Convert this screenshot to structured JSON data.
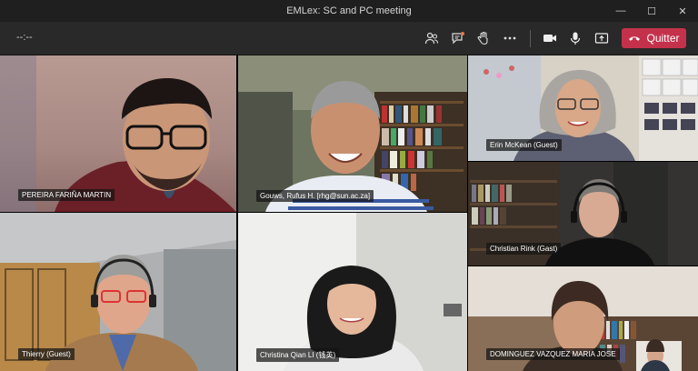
{
  "window": {
    "title": "EMLex: SC and PC meeting",
    "minimize": "—",
    "maximize": "☐",
    "close": "✕"
  },
  "toolbar": {
    "timer": "--:--",
    "leave_label": "Quitter"
  },
  "colors": {
    "accent_leave": "#c4314b",
    "toolbar_bg": "#292929",
    "titlebar_bg": "#1f1f1f"
  },
  "participants": [
    {
      "name": "PEREIRA FARIÑA MARTIN"
    },
    {
      "name": "Gouws, Rufus H. [rhg@sun.ac.za]"
    },
    {
      "name": "Erin McKean (Guest)"
    },
    {
      "name": "Christian Rink (Gast)"
    },
    {
      "name": "Thierry (Guest)"
    },
    {
      "name": "Christina Qian LI (钱英)"
    },
    {
      "name": "DOMINGUEZ VAZQUEZ MARIA JOSE"
    }
  ]
}
